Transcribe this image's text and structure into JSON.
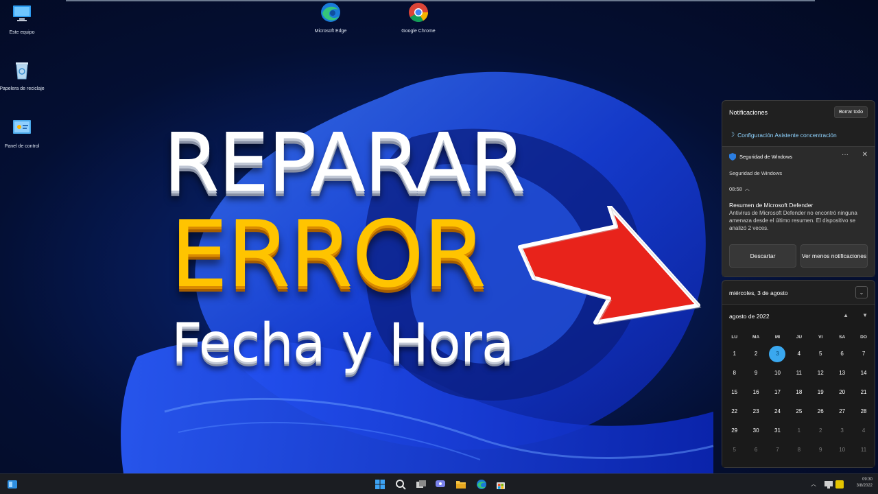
{
  "desktop": {
    "icons": [
      {
        "label": "Este equipo",
        "icon": "computer-icon"
      },
      {
        "label": "Papelera de reciclaje",
        "icon": "recycle-bin-icon"
      },
      {
        "label": "Panel de control",
        "icon": "control-panel-icon"
      },
      {
        "label": "Microsoft Edge",
        "icon": "edge-icon"
      },
      {
        "label": "Google Chrome",
        "icon": "chrome-icon"
      }
    ]
  },
  "overlay": {
    "line1": "REPARAR",
    "line2": "ERROR",
    "line3": "Fecha y Hora",
    "line1_color": "#ffffff",
    "line2_color": "#ffc400",
    "arrow_color": "#e8231b"
  },
  "notifications": {
    "header": "Notificaciones",
    "clear_all": "Borrar todo",
    "focus_link": "Configuración Asistente concentración",
    "card": {
      "app": "Seguridad de Windows",
      "more": "···",
      "close": "✕",
      "app_line": "Seguridad de Windows",
      "time": "08:58",
      "title": "Resumen de Microsoft Defender",
      "body": "Antivirus de Microsoft Defender no encontró ninguna amenaza desde el último resumen.  El dispositivo se analizó 2 veces.",
      "dismiss": "Descartar",
      "show_less": "Ver menos notificaciones"
    }
  },
  "calendar": {
    "date_header": "miércoles, 3 de agosto",
    "month": "agosto de 2022",
    "weekdays": [
      "LU",
      "MA",
      "MI",
      "JU",
      "VI",
      "SA",
      "DO"
    ],
    "days": [
      {
        "d": "1"
      },
      {
        "d": "2"
      },
      {
        "d": "3",
        "today": true
      },
      {
        "d": "4"
      },
      {
        "d": "5"
      },
      {
        "d": "6"
      },
      {
        "d": "7"
      },
      {
        "d": "8"
      },
      {
        "d": "9"
      },
      {
        "d": "10"
      },
      {
        "d": "11"
      },
      {
        "d": "12"
      },
      {
        "d": "13"
      },
      {
        "d": "14"
      },
      {
        "d": "15"
      },
      {
        "d": "16"
      },
      {
        "d": "17"
      },
      {
        "d": "18"
      },
      {
        "d": "19"
      },
      {
        "d": "20"
      },
      {
        "d": "21"
      },
      {
        "d": "22"
      },
      {
        "d": "23"
      },
      {
        "d": "24"
      },
      {
        "d": "25"
      },
      {
        "d": "26"
      },
      {
        "d": "27"
      },
      {
        "d": "28"
      },
      {
        "d": "29"
      },
      {
        "d": "30"
      },
      {
        "d": "31"
      },
      {
        "d": "1",
        "muted": true
      },
      {
        "d": "2",
        "muted": true
      },
      {
        "d": "3",
        "muted": true
      },
      {
        "d": "4",
        "muted": true
      },
      {
        "d": "5",
        "muted": true
      },
      {
        "d": "6",
        "muted": true
      },
      {
        "d": "7",
        "muted": true
      },
      {
        "d": "8",
        "muted": true
      },
      {
        "d": "9",
        "muted": true
      },
      {
        "d": "10",
        "muted": true
      },
      {
        "d": "11",
        "muted": true
      }
    ],
    "accent": "#3aa8ef"
  },
  "taskbar": {
    "icons": [
      "start-icon",
      "search-icon",
      "task-view-icon",
      "chat-icon",
      "file-explorer-icon",
      "edge-icon",
      "store-icon"
    ],
    "time": "09:30",
    "date": "3/8/2022"
  }
}
